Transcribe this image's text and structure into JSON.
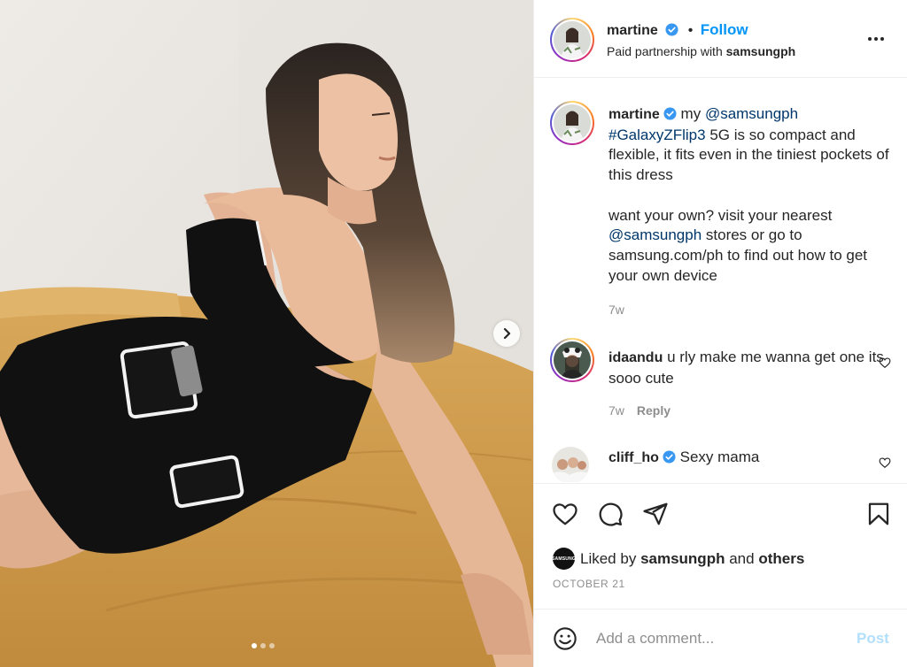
{
  "post_header": {
    "username": "martine",
    "separator": "•",
    "follow_label": "Follow",
    "subtitle_prefix": "Paid partnership with",
    "partner": "samsungph"
  },
  "caption": {
    "username": "martine",
    "text_1": "my",
    "mention_1": "@samsungph",
    "hashtag": "#GalaxyZFlip3",
    "text_2": "5G is so compact and flexible, it fits even in the tiniest pockets of this dress",
    "text_3": "want your own? visit your nearest",
    "mention_2": "@samsungph",
    "text_4": "stores or go to samsung.com/ph to find out how to get your own device",
    "time": "7w"
  },
  "comments": [
    {
      "username": "idaandu",
      "text": "u rly make me wanna get one its sooo cute",
      "time": "7w",
      "reply_label": "Reply"
    },
    {
      "username": "cliff_ho",
      "text": "Sexy mama",
      "verified": true
    }
  ],
  "likes": {
    "avatar_text": "SAMSUNG",
    "prefix": "Liked by",
    "user": "samsungph",
    "and": "and",
    "others": "others"
  },
  "date": "OCTOBER 21",
  "comment_box": {
    "placeholder": "Add a comment...",
    "post_label": "Post"
  },
  "carousel": {
    "count": 3,
    "active": 0
  },
  "colors": {
    "link_blue": "#0095f6",
    "mention_blue": "#00376b",
    "muted": "#8e8e8e",
    "verified": "#3897f0",
    "post_disabled": "#b2dffc"
  },
  "icons": [
    "heart-icon",
    "comment-icon",
    "share-icon",
    "bookmark-icon",
    "emoji-icon",
    "more-icon",
    "chevron-right-icon",
    "verified-icon"
  ]
}
